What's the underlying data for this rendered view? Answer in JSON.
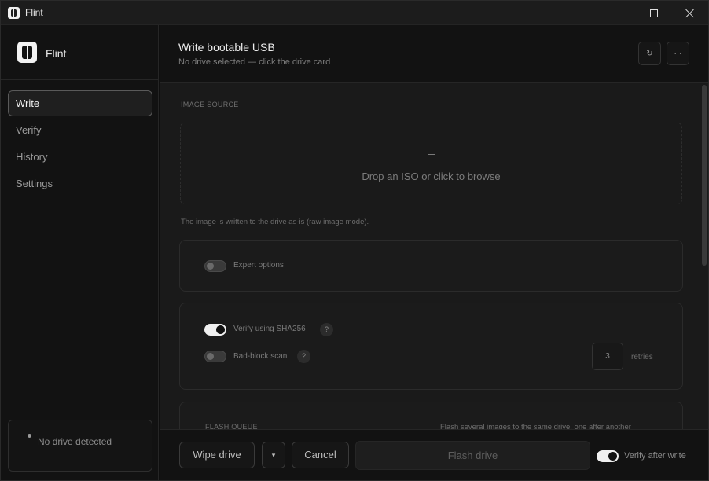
{
  "window": {
    "title": "Flint",
    "controls": {
      "minimize": "minimize-icon",
      "maximize": "maximize-icon",
      "close": "close-icon"
    }
  },
  "sidebar": {
    "brand": "Flint",
    "items": [
      {
        "label": "Write",
        "active": true
      },
      {
        "label": "Verify",
        "active": false
      },
      {
        "label": "History",
        "active": false
      },
      {
        "label": "Settings",
        "active": false
      }
    ],
    "drive_status": "No drive detected"
  },
  "header": {
    "title": "Write bootable USB",
    "subtitle": "No drive selected — click the drive card",
    "refresh_icon": "↻",
    "more_icon": "···"
  },
  "main": {
    "image_source_label": "IMAGE SOURCE",
    "dropzone_text": "Drop an ISO or click to browse",
    "image_note": "The image is written to the drive as-is (raw image mode).",
    "expert_options": {
      "label": "Expert options",
      "on": false
    },
    "verify_sha": {
      "label": "Verify using SHA256",
      "on": true,
      "help": "?"
    },
    "bad_block": {
      "label": "Bad-block scan",
      "on": false,
      "help": "?"
    },
    "retries": {
      "value": "3",
      "label": "retries"
    },
    "flash_queue": {
      "title": "FLASH QUEUE",
      "description": "Flash several images to the same drive, one after another"
    }
  },
  "footer": {
    "wipe_label": "Wipe drive",
    "caret": "▾",
    "cancel_label": "Cancel",
    "flash_label": "Flash drive",
    "verify_after": {
      "label": "Verify after write",
      "on": true
    }
  },
  "colors": {
    "background": "#0f0f0f",
    "panel": "#1a1a1a",
    "accent": "#f0f0f0"
  }
}
